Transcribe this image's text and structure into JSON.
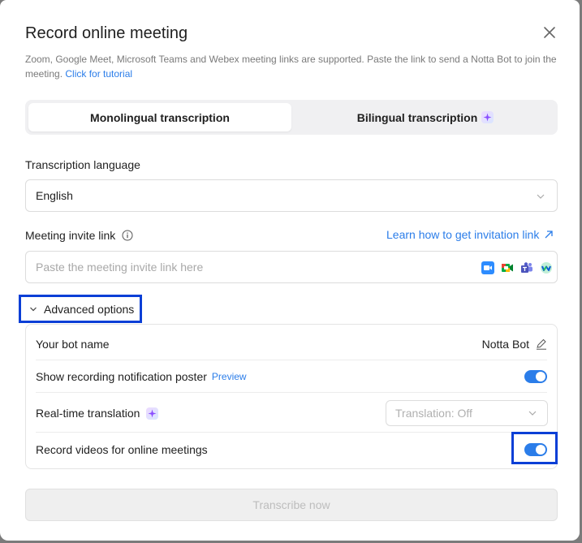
{
  "dialog": {
    "title": "Record online meeting",
    "description": "Zoom, Google Meet, Microsoft Teams and Webex meeting links are supported. Paste the link to send a Notta Bot to join the meeting.",
    "tutorial_link": "Click for tutorial"
  },
  "tabs": [
    {
      "label": "Monolingual transcription",
      "active": true
    },
    {
      "label": "Bilingual transcription",
      "active": false
    }
  ],
  "language": {
    "label": "Transcription language",
    "value": "English"
  },
  "invite": {
    "label": "Meeting invite link",
    "learn_link": "Learn how to get invitation link",
    "placeholder": "Paste the meeting invite link here",
    "apps": [
      "zoom-icon",
      "google-meet-icon",
      "teams-icon",
      "webex-icon"
    ]
  },
  "advanced": {
    "label": "Advanced options",
    "bot_name_label": "Your bot name",
    "bot_name_value": "Notta Bot",
    "poster_label": "Show recording notification poster",
    "poster_preview": "Preview",
    "poster_enabled": true,
    "translation_label": "Real-time translation",
    "translation_value": "Translation: Off",
    "record_video_label": "Record videos for online meetings",
    "record_video_enabled": true
  },
  "submit_label": "Transcribe now",
  "colors": {
    "accent": "#2b7de9",
    "highlight_box": "#0a3fd6"
  }
}
